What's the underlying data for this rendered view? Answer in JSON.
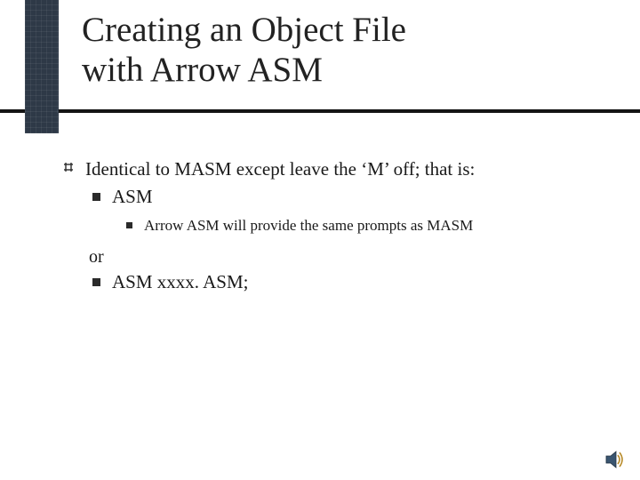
{
  "title": {
    "line1": "Creating an Object File",
    "line2": "with Arrow ASM"
  },
  "body": {
    "l1": "Identical to MASM except leave the ‘M’ off;  that is:",
    "l2a": "ASM",
    "l3a": "Arrow ASM will provide the same prompts as MASM",
    "or": "or",
    "l2b": "ASM xxxx. ASM;"
  },
  "icons": {
    "sound": "sound-icon"
  }
}
